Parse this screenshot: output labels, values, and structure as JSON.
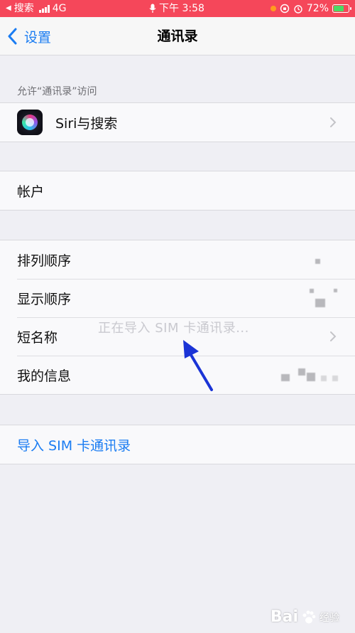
{
  "status_bar": {
    "back_app": "搜索",
    "network": "4G",
    "time": "下午 3:58",
    "battery": "72%",
    "battery_level": 0.72
  },
  "nav": {
    "back_label": "设置",
    "title": "通讯录"
  },
  "sections": {
    "allow_access_header": "允许“通讯录”访问",
    "siri_label": "Siri与搜索",
    "accounts_label": "帐户",
    "sort_order_label": "排列顺序",
    "display_order_label": "显示顺序",
    "short_name_label": "短名称",
    "my_info_label": "我的信息",
    "import_sim_label": "导入 SIM 卡通讯录"
  },
  "overlay": {
    "importing_text": "正在导入 SIM 卡通讯录..."
  },
  "watermark": {
    "text": "Bai",
    "sub": "经验"
  },
  "colors": {
    "status_bar_bg": "#f5475a",
    "link_blue": "#1a7cf2",
    "arrow_blue": "#1b34d6"
  }
}
